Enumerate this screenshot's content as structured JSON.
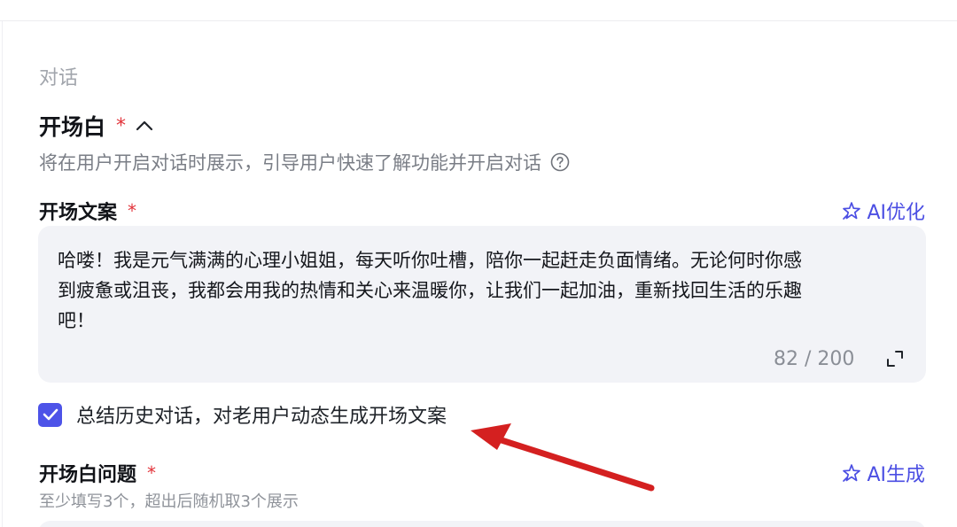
{
  "section": {
    "title": "对话"
  },
  "opener": {
    "title": "开场白",
    "required_mark": "*",
    "description": "将在用户开启对话时展示，引导用户快速了解功能并开启对话"
  },
  "opener_text": {
    "label": "开场文案",
    "required_mark": "*",
    "ai_button": "AI优化",
    "value_line1": "哈喽！我是元气满满的心理小姐姐，每天听你吐槽，陪你一起赶走负面情绪。无论何时你感",
    "value_line2": "到疲惫或沮丧，我都会用我的热情和关心来温暖你，让我们一起加油，重新找回生活的乐趣",
    "value_line3": "吧！",
    "counter": "82 / 200"
  },
  "summary_checkbox": {
    "checked": true,
    "label": "总结历史对话，对老用户动态生成开场文案"
  },
  "opener_questions": {
    "label": "开场白问题",
    "required_mark": "*",
    "ai_button": "AI生成",
    "description": "至少填写3个，超出后随机取3个展示"
  },
  "colors": {
    "accent": "#4d53e8",
    "link": "#4b4ee3",
    "required": "#e2333a",
    "annotation_arrow": "#d42020"
  }
}
